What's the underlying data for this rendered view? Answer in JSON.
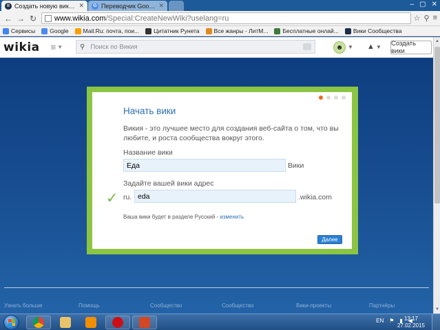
{
  "browser": {
    "tabs": [
      {
        "label": "Создать новую вики — W",
        "active": true
      },
      {
        "label": "Переводчик Google",
        "active": false
      }
    ],
    "url_host": "www.wikia.com",
    "url_path": "/Special:CreateNewWiki?uselang=ru",
    "bookmarks": [
      {
        "label": "Сервисы",
        "icon": "apps-grid-icon",
        "color": "#4285f4"
      },
      {
        "label": "Google",
        "icon": "google-icon",
        "color": "#4a8af4"
      },
      {
        "label": "Mail.Ru: почта, пои...",
        "icon": "mailru-icon",
        "color": "#ff9e00"
      },
      {
        "label": "Цитатник Рунета",
        "icon": "bash-icon",
        "color": "#333333"
      },
      {
        "label": "Все жанры - ЛитМ...",
        "icon": "litmir-icon",
        "color": "#e08a1e"
      },
      {
        "label": "Бесплатные онлай...",
        "icon": "globe-icon",
        "color": "#3b7a3b"
      },
      {
        "label": "Вики Сообщества",
        "icon": "wikia-icon",
        "color": "#1d2d4a"
      }
    ]
  },
  "header": {
    "logo": "wikia",
    "search_placeholder": "Поиск по Викия",
    "create_wiki_label": "Создать вики"
  },
  "modal": {
    "title": "Начать вики",
    "description": "Викия - это лучшее место для создания веб-сайта о том, что вы любите, и роста сообщества вокруг этого.",
    "name_label": "Название вики",
    "name_value": "Еда",
    "name_suffix": "Вики",
    "address_label": "Задайте вашей вики адрес",
    "address_prefix": "ru.",
    "address_value": "eda",
    "address_suffix": ".wikia.com",
    "lang_note_text": "Ваша вики будет в разделе Русский - ",
    "lang_note_link": "изменить",
    "next_label": "Далее",
    "progress_step": 1,
    "progress_total": 4
  },
  "footer": {
    "links": [
      "Узнать больше",
      "Помощь",
      "Сообщество",
      "Сообщество",
      "Вики-проекты",
      "Партнёры"
    ]
  },
  "taskbar": {
    "lang": "EN",
    "time": "13:17",
    "date": "27.02.2015",
    "apps": [
      "chrome-icon",
      "explorer-icon",
      "media-player-icon",
      "opera-icon",
      "presentation-icon"
    ]
  },
  "colors": {
    "accent_green": "#8cc543",
    "link_blue": "#2a6fb3",
    "page_blue": "#1a4b8f",
    "progress_orange": "#f26522"
  }
}
